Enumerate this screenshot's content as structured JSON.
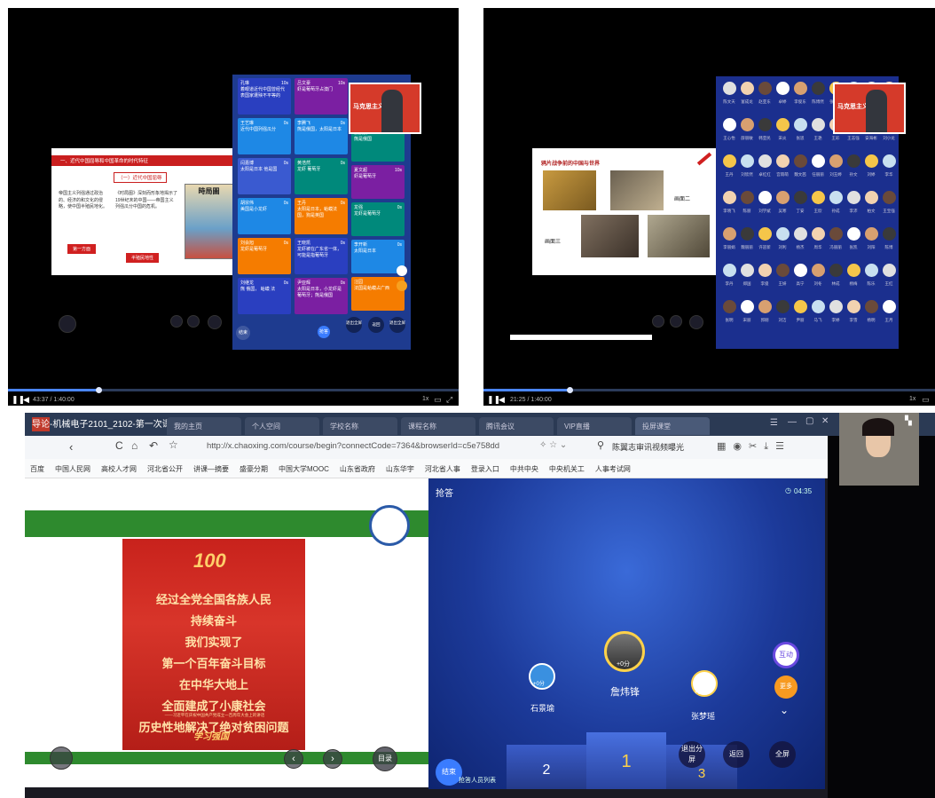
{
  "top_left": {
    "slide_heading": "一、近代中国屈辱和中国革命的时代特征",
    "slide_subheading": "（一）近代中国屈辱",
    "slide_body_left": "帝国主义列强通过政治的、经济的和文化的侵略，使中国半殖民地化。",
    "slide_body_mid": "《时局图》深刻而形象地揭示了19世纪末的中国——帝国主义列强瓜分中国的危机。",
    "slide_map_title": "時局圖",
    "slide_btn1": "第一方面",
    "slide_btn2": "半殖民地性",
    "cards": [
      {
        "name": "孔琳",
        "time": "10s",
        "text": "着眼道近代中国曾经代表国家遭殃不平等的"
      },
      {
        "name": "王艺琳",
        "time": "0s",
        "text": "近代中国列强瓜分"
      },
      {
        "name": "闫嘉博",
        "time": "0s",
        "text": "太阳是日本 他是国"
      },
      {
        "name": "胡宗伟",
        "time": "0s",
        "text": "美国是小龙虾"
      },
      {
        "name": "刘会旭",
        "time": "0s",
        "text": "龙虾是葡萄牙"
      },
      {
        "name": "刘继龙",
        "time": "0s",
        "text": "熊 俄国， 蛤蟆 法"
      },
      {
        "name": "吕文豪",
        "time": "10s",
        "text": "虾是葡萄牙占澳门"
      },
      {
        "name": "李腾飞",
        "time": "0s",
        "text": "熊是俄国，太阳是日本"
      },
      {
        "name": "黄浩然",
        "time": "0s",
        "text": "龙虾 葡萄牙"
      },
      {
        "name": "王丹",
        "time": "0s",
        "text": "太阳是日本，蛤蟆法国，狗是英国"
      },
      {
        "name": "王晓凯",
        "time": "0s",
        "text": "龙虾被在广东省一体，可能是指葡萄牙"
      },
      {
        "name": "尹亚辉",
        "time": "0s",
        "text": "太阳是日本，小龙虾是葡萄牙；熊是俄国"
      },
      {
        "name": "张晨晨",
        "time": "0s",
        "text": "熊是俄国"
      },
      {
        "name": "夏文超",
        "time": "10s",
        "text": "虾是葡萄牙"
      },
      {
        "name": "龙强",
        "time": "0s",
        "text": "龙虾是葡萄牙"
      },
      {
        "name": "李开新",
        "time": "0s",
        "text": "太阳是日本"
      },
      {
        "name": "汪园",
        "time": "",
        "text": "法国是蛤蟆占广西"
      }
    ],
    "cam_text": "马克思主义学院",
    "btn_close": "结束",
    "btn_fullscreen": "退出全屏",
    "btn_return": "返回",
    "btn_exit": "退出全屏",
    "btn_circle": "抢答",
    "time": "43:37 / 1:40:00",
    "speed": "1x",
    "progress": 0.2
  },
  "top_right": {
    "slide_heading": "鸦片战争前的中国与世界",
    "label_picture2": "画面二",
    "label_picture3": "画面三",
    "cam_text": "马克思主义学院",
    "time": "21:25 / 1:40:00",
    "speed": "1x",
    "progress": 0.19,
    "grid_rows": [
      [
        "陈文天",
        "富成龙",
        "赵亚东",
        "卓婷",
        "李俊东",
        "陈博然",
        "张思成",
        "王艺",
        "刘欣",
        "刘利"
      ],
      [
        "王心怡",
        "薛丽敏",
        "韩亚民",
        "宋炎",
        "张思",
        "王艳",
        "王彩",
        "王志强",
        "安海彬",
        "刘小龙"
      ],
      [
        "王丹",
        "刘欣然",
        "卓红红",
        "宫雨萌",
        "魏文茜",
        "任丽丽",
        "刘玉婷",
        "孙文",
        "刘婷",
        "李华"
      ],
      [
        "李晓飞",
        "陈丽",
        "刘学斌",
        "吴寒",
        "丁安",
        "王欣",
        "孙成",
        "李沛",
        "柏文",
        "王宝强"
      ],
      [
        "李丽娟",
        "魏丽丽",
        "许迎新",
        "刘利",
        "杨杰",
        "周华",
        "冯丽丽",
        "张凯",
        "刘阳",
        "陈博"
      ],
      [
        "李丹",
        "郑国",
        "李俊",
        "王妍",
        "高宁",
        "刘冬",
        "林成",
        "杨梅",
        "陈乐",
        "王红"
      ],
      [
        "张明",
        "宋丽",
        "郭刚",
        "刘洁",
        "尹丽",
        "马飞",
        "李婷",
        "李雪",
        "杨明",
        "王月"
      ]
    ]
  },
  "bottom": {
    "window_title": "导论-机械电子2101_2102-第一次课",
    "tabs": [
      "我的主页",
      "个人空间",
      "学校名称",
      "课程名称",
      "腾讯会议",
      "VIP直播",
      "投屏课堂"
    ],
    "url": "http://x.chaoxing.com/course/begin?connectCode=7364&browserId=c5e758dd",
    "search_text": "陈翼志审讯视频曝光",
    "bookmarks": [
      "百度",
      "中国人民网",
      "高校人才网",
      "河北省公开",
      "讲课—摘要",
      "盛豪分期",
      "中国大学MOOC",
      "山东省政府",
      "山东华宇",
      "河北省人事",
      "登录入口",
      "中共中央",
      "中央机关工",
      "人事考试网"
    ],
    "poster_lines": [
      "经过全党全国各族人民",
      "持续奋斗",
      "我们实现了",
      "第一个百年奋斗目标",
      "在中华大地上",
      "全面建成了小康社会",
      "历史性地解决了绝对贫困问题"
    ],
    "poster_caption": "——习近平在庆祝中国共产党成立一百周年大会上的讲话",
    "poster_brand": "学习强国",
    "poster_100": "100",
    "slide_btn_menu": "目录",
    "panel_title": "抢答",
    "timer": "04:35",
    "winner1_name": "詹炜锋",
    "winner1_score": "+0分",
    "winner2_name": "石景瑜",
    "winner2_score": "+0分",
    "winner3_name": "张梦瑶",
    "winner3_score": "+0分",
    "podium": [
      "2",
      "1",
      "3"
    ],
    "btn_interact": "互动",
    "btn_more": "更多",
    "btn_end": "结束",
    "btn_list": "抢答人员列表",
    "btn_exit_split": "退出分屏",
    "btn_back": "返回",
    "btn_full": "全屏"
  }
}
